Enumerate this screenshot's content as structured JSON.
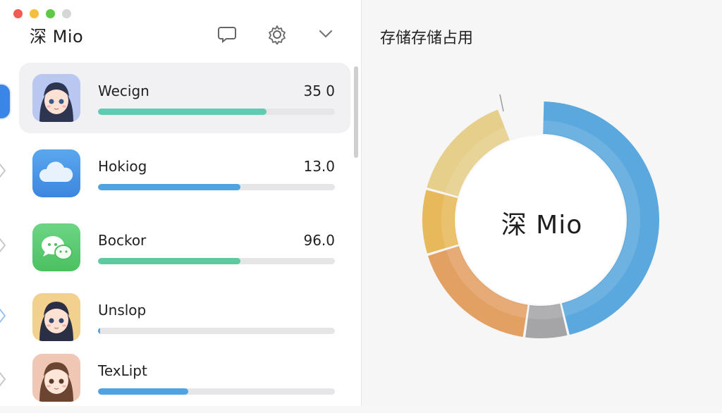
{
  "window": {
    "title": "深 Mio"
  },
  "header": {
    "icons": [
      "chat-bubble-icon",
      "gear-icon",
      "chevron-down-icon"
    ]
  },
  "apps": [
    {
      "name": "Wecign",
      "size": "35 0",
      "fraction": 0.71,
      "color": "#5fcbb0",
      "icon": "anime-girl-icon"
    },
    {
      "name": "Hokiog",
      "size": "13.0",
      "fraction": 0.6,
      "color": "#4ea3e0",
      "icon": "cloud-icon"
    },
    {
      "name": "Bockor",
      "size": "96.0",
      "fraction": 0.6,
      "color": "#5fcaa2",
      "icon": "chat-bubbles-icon"
    },
    {
      "name": "Unslop",
      "size": "",
      "fraction": 0.01,
      "color": "#4ea3e0",
      "icon": "anime-girl-icon"
    },
    {
      "name": "TexLipt",
      "size": "",
      "fraction": 0.38,
      "color": "#4ea3e0",
      "icon": "anime-girl-brown-icon"
    }
  ],
  "storage_panel": {
    "title": "存储存储占用",
    "center_label": "深 Mio",
    "segments": [
      {
        "color": "#5aa8de",
        "fraction": 0.46
      },
      {
        "color": "#a5a5a8",
        "fraction": 0.06
      },
      {
        "color": "#e3a063",
        "fraction": 0.18
      },
      {
        "color": "#e8b95a",
        "fraction": 0.09
      },
      {
        "color": "#e6cf8a",
        "fraction": 0.15
      }
    ]
  }
}
